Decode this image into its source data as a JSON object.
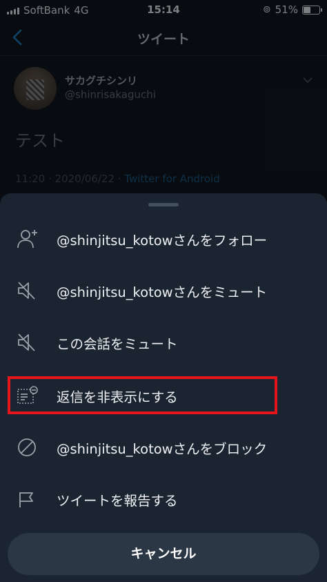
{
  "status_bar": {
    "carrier": "SoftBank",
    "network": "4G",
    "time": "15:14",
    "battery_percent": "51%",
    "battery_level": 0.51
  },
  "header": {
    "title": "ツイート",
    "back_icon": "chevron-left-icon"
  },
  "tweet": {
    "display_name": "サカグチシンリ",
    "handle": "@shinrisakaguchi",
    "text": "テスト",
    "timestamp": "11:20 · 2020/06/22 · ",
    "source": "Twitter for Android"
  },
  "menu": {
    "items": [
      {
        "label": "@shinjitsu_kotowさんをフォロー",
        "icon": "follow-user-icon"
      },
      {
        "label": "@shinjitsu_kotowさんをミュート",
        "icon": "mute-icon"
      },
      {
        "label": "この会話をミュート",
        "icon": "mute-icon"
      },
      {
        "label": "返信を非表示にする",
        "icon": "hide-reply-icon"
      },
      {
        "label": "@shinjitsu_kotowさんをブロック",
        "icon": "block-icon"
      },
      {
        "label": "ツイートを報告する",
        "icon": "flag-icon"
      }
    ],
    "cancel_label": "キャンセル"
  },
  "colors": {
    "sheet_background": "#1b2431",
    "highlight_border": "#e8141b",
    "accent_blue": "#1b6fa8"
  }
}
